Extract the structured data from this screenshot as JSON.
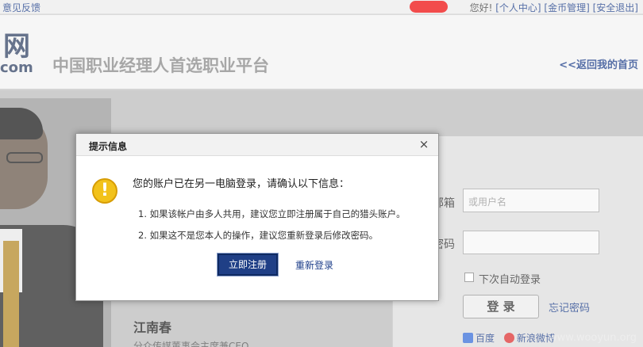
{
  "topbar": {
    "feedback": "意见反馈",
    "greeting": "您好!",
    "links": [
      "[个人中心]",
      "[金币管理]",
      "[安全退出]"
    ]
  },
  "header": {
    "logo": "网",
    "logo_suffix": "com",
    "slogan": "中国职业经理人首选职业平台",
    "back_link": "<<返回我的首页"
  },
  "profile": {
    "name": "江南春",
    "title": "分众传媒董事会主席兼CEO"
  },
  "login": {
    "username_label": "邮箱",
    "username_placeholder": "或用户名",
    "password_label": "密码",
    "remember_label": "下次自动登录",
    "login_button": "登 录",
    "forgot_link": "忘记密码",
    "share_baidu": "百度",
    "share_weibo": "新浪微博"
  },
  "modal": {
    "title": "提示信息",
    "close": "×",
    "icon": "!",
    "heading": "您的账户已在另一电脑登录，请确认以下信息：",
    "items": [
      "1.  如果该帐户由多人共用，建议您立即注册属于自己的猎头账户。",
      "2.  如果这不是您本人的操作，建议您重新登录后修改密码。"
    ],
    "primary_button": "立即注册",
    "secondary_link": "重新登录"
  },
  "watermark": "www.wooyun.org",
  "colors": {
    "brand_blue": "#1f3f86",
    "link_blue": "#1e3f8a",
    "warning_yellow": "#f2c21b"
  }
}
